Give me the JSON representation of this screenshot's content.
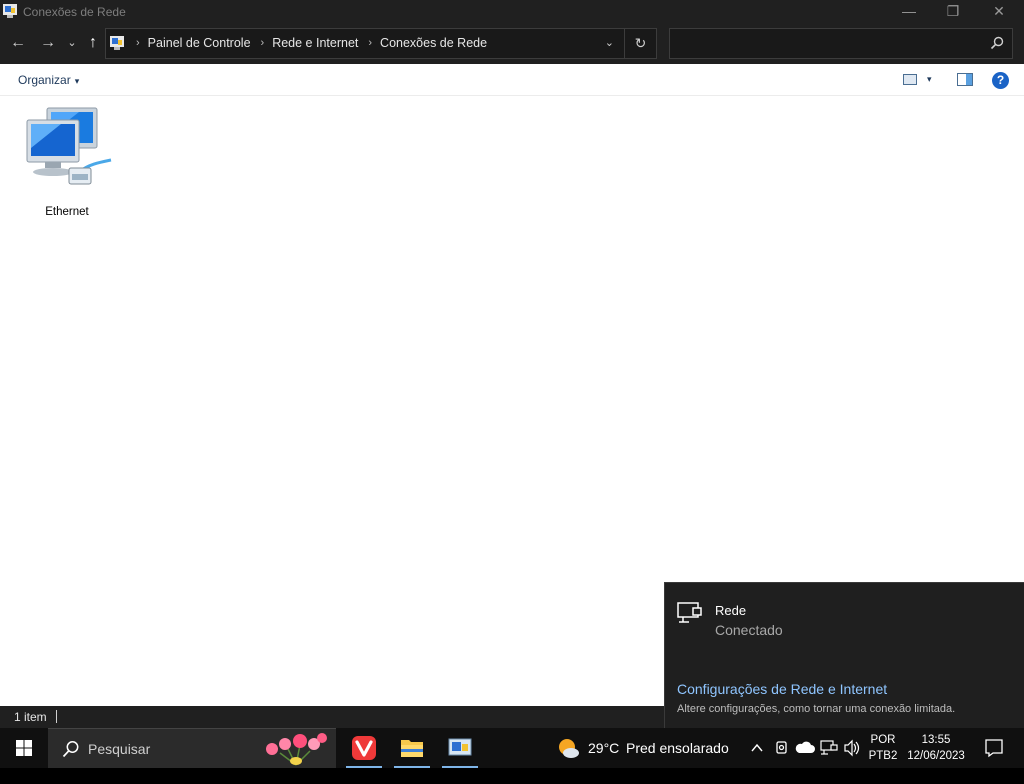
{
  "window": {
    "title": "Conexões de Rede",
    "minimize_glyph": "—",
    "restore_glyph": "❐",
    "close_glyph": "✕"
  },
  "nav": {
    "back_glyph": "←",
    "forward_glyph": "→",
    "recent_glyph": "⌄",
    "up_glyph": "↑"
  },
  "address": {
    "breadcrumbs": [
      "Painel de Controle",
      "Rede e Internet",
      "Conexões de Rede"
    ],
    "separator": "›",
    "dropdown_glyph": "⌄",
    "refresh_glyph": "↻"
  },
  "search": {
    "placeholder": ""
  },
  "toolbar": {
    "organize_label": "Organizar",
    "caret": "▾",
    "help_label": "?"
  },
  "content": {
    "items": [
      {
        "label": "Ethernet",
        "icon": "network-computers-icon"
      }
    ]
  },
  "status": {
    "item_count": "1 item"
  },
  "flyout": {
    "network_name": "Rede",
    "network_state": "Conectado",
    "settings_link": "Configurações de Rede e Internet",
    "settings_desc": "Altere configurações, como tornar uma conexão limitada."
  },
  "taskbar": {
    "search_placeholder": "Pesquisar",
    "temperature": "29°C",
    "weather_condition": "Pred ensolarado",
    "language_line1": "POR",
    "language_line2": "PTB2",
    "time": "13:55",
    "date": "12/06/2023"
  },
  "colors": {
    "dark_chrome": "#202020",
    "taskbar": "#101010",
    "link": "#8fc5ff",
    "accent": "#1a63c6"
  }
}
